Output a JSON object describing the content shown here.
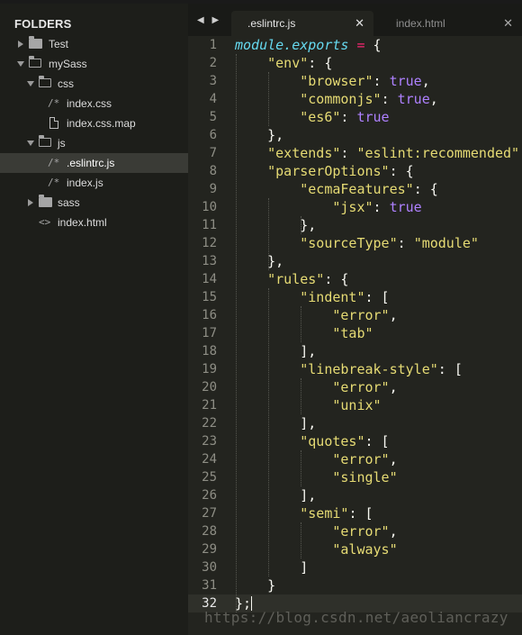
{
  "sidebar": {
    "title": "FOLDERS",
    "items": [
      {
        "label": "Test"
      },
      {
        "label": "mySass"
      },
      {
        "label": "css"
      },
      {
        "label": "index.css",
        "glyph": "/*"
      },
      {
        "label": "index.css.map"
      },
      {
        "label": "js"
      },
      {
        "label": ".eslintrc.js",
        "glyph": "/*"
      },
      {
        "label": "index.js",
        "glyph": "/*"
      },
      {
        "label": "sass"
      },
      {
        "label": "index.html",
        "glyph": "<>"
      }
    ]
  },
  "tabs": {
    "nav": "◀ ▶",
    "active": {
      "label": ".eslintrc.js",
      "close": "✕"
    },
    "inactive": {
      "label": "index.html",
      "close": "✕"
    }
  },
  "editor": {
    "line_numbers": [
      "1",
      "2",
      "3",
      "4",
      "5",
      "6",
      "7",
      "8",
      "9",
      "10",
      "11",
      "12",
      "13",
      "14",
      "15",
      "16",
      "17",
      "18",
      "19",
      "20",
      "21",
      "22",
      "23",
      "24",
      "25",
      "26",
      "27",
      "28",
      "29",
      "30",
      "31",
      "32"
    ],
    "lines": [
      {
        "parts": [
          {
            "t": "module.exports",
            "c": "kw-obj"
          },
          {
            "t": " ",
            "c": "pun"
          },
          {
            "t": "=",
            "c": "op"
          },
          {
            "t": " {",
            "c": "pun"
          }
        ]
      },
      {
        "parts": [
          {
            "t": "    ",
            "c": "pun"
          },
          {
            "t": "\"env\"",
            "c": "str"
          },
          {
            "t": ": {",
            "c": "pun"
          }
        ]
      },
      {
        "parts": [
          {
            "t": "        ",
            "c": "pun"
          },
          {
            "t": "\"browser\"",
            "c": "str"
          },
          {
            "t": ": ",
            "c": "pun"
          },
          {
            "t": "true",
            "c": "boo"
          },
          {
            "t": ",",
            "c": "pun"
          }
        ]
      },
      {
        "parts": [
          {
            "t": "        ",
            "c": "pun"
          },
          {
            "t": "\"commonjs\"",
            "c": "str"
          },
          {
            "t": ": ",
            "c": "pun"
          },
          {
            "t": "true",
            "c": "boo"
          },
          {
            "t": ",",
            "c": "pun"
          }
        ]
      },
      {
        "parts": [
          {
            "t": "        ",
            "c": "pun"
          },
          {
            "t": "\"es6\"",
            "c": "str"
          },
          {
            "t": ": ",
            "c": "pun"
          },
          {
            "t": "true",
            "c": "boo"
          }
        ]
      },
      {
        "parts": [
          {
            "t": "    },",
            "c": "pun"
          }
        ]
      },
      {
        "parts": [
          {
            "t": "    ",
            "c": "pun"
          },
          {
            "t": "\"extends\"",
            "c": "str"
          },
          {
            "t": ": ",
            "c": "pun"
          },
          {
            "t": "\"eslint:recommended\"",
            "c": "str"
          },
          {
            "t": ",",
            "c": "pun"
          }
        ]
      },
      {
        "parts": [
          {
            "t": "    ",
            "c": "pun"
          },
          {
            "t": "\"parserOptions\"",
            "c": "str"
          },
          {
            "t": ": {",
            "c": "pun"
          }
        ]
      },
      {
        "parts": [
          {
            "t": "        ",
            "c": "pun"
          },
          {
            "t": "\"ecmaFeatures\"",
            "c": "str"
          },
          {
            "t": ": {",
            "c": "pun"
          }
        ]
      },
      {
        "parts": [
          {
            "t": "            ",
            "c": "pun"
          },
          {
            "t": "\"jsx\"",
            "c": "str"
          },
          {
            "t": ": ",
            "c": "pun"
          },
          {
            "t": "true",
            "c": "boo"
          }
        ]
      },
      {
        "parts": [
          {
            "t": "        },",
            "c": "pun"
          }
        ]
      },
      {
        "parts": [
          {
            "t": "        ",
            "c": "pun"
          },
          {
            "t": "\"sourceType\"",
            "c": "str"
          },
          {
            "t": ": ",
            "c": "pun"
          },
          {
            "t": "\"module\"",
            "c": "str"
          }
        ]
      },
      {
        "parts": [
          {
            "t": "    },",
            "c": "pun"
          }
        ]
      },
      {
        "parts": [
          {
            "t": "    ",
            "c": "pun"
          },
          {
            "t": "\"rules\"",
            "c": "str"
          },
          {
            "t": ": {",
            "c": "pun"
          }
        ]
      },
      {
        "parts": [
          {
            "t": "        ",
            "c": "pun"
          },
          {
            "t": "\"indent\"",
            "c": "str"
          },
          {
            "t": ": [",
            "c": "pun"
          }
        ]
      },
      {
        "parts": [
          {
            "t": "            ",
            "c": "pun"
          },
          {
            "t": "\"error\"",
            "c": "str"
          },
          {
            "t": ",",
            "c": "pun"
          }
        ]
      },
      {
        "parts": [
          {
            "t": "            ",
            "c": "pun"
          },
          {
            "t": "\"tab\"",
            "c": "str"
          }
        ]
      },
      {
        "parts": [
          {
            "t": "        ],",
            "c": "pun"
          }
        ]
      },
      {
        "parts": [
          {
            "t": "        ",
            "c": "pun"
          },
          {
            "t": "\"linebreak-style\"",
            "c": "str"
          },
          {
            "t": ": [",
            "c": "pun"
          }
        ]
      },
      {
        "parts": [
          {
            "t": "            ",
            "c": "pun"
          },
          {
            "t": "\"error\"",
            "c": "str"
          },
          {
            "t": ",",
            "c": "pun"
          }
        ]
      },
      {
        "parts": [
          {
            "t": "            ",
            "c": "pun"
          },
          {
            "t": "\"unix\"",
            "c": "str"
          }
        ]
      },
      {
        "parts": [
          {
            "t": "        ],",
            "c": "pun"
          }
        ]
      },
      {
        "parts": [
          {
            "t": "        ",
            "c": "pun"
          },
          {
            "t": "\"quotes\"",
            "c": "str"
          },
          {
            "t": ": [",
            "c": "pun"
          }
        ]
      },
      {
        "parts": [
          {
            "t": "            ",
            "c": "pun"
          },
          {
            "t": "\"error\"",
            "c": "str"
          },
          {
            "t": ",",
            "c": "pun"
          }
        ]
      },
      {
        "parts": [
          {
            "t": "            ",
            "c": "pun"
          },
          {
            "t": "\"single\"",
            "c": "str"
          }
        ]
      },
      {
        "parts": [
          {
            "t": "        ],",
            "c": "pun"
          }
        ]
      },
      {
        "parts": [
          {
            "t": "        ",
            "c": "pun"
          },
          {
            "t": "\"semi\"",
            "c": "str"
          },
          {
            "t": ": [",
            "c": "pun"
          }
        ]
      },
      {
        "parts": [
          {
            "t": "            ",
            "c": "pun"
          },
          {
            "t": "\"error\"",
            "c": "str"
          },
          {
            "t": ",",
            "c": "pun"
          }
        ]
      },
      {
        "parts": [
          {
            "t": "            ",
            "c": "pun"
          },
          {
            "t": "\"always\"",
            "c": "str"
          }
        ]
      },
      {
        "parts": [
          {
            "t": "        ]",
            "c": "pun"
          }
        ]
      },
      {
        "parts": [
          {
            "t": "    }",
            "c": "pun"
          }
        ]
      },
      {
        "parts": [
          {
            "t": "};",
            "c": "pun"
          }
        ]
      }
    ]
  },
  "watermark": "https://blog.csdn.net/aeoliancrazy"
}
